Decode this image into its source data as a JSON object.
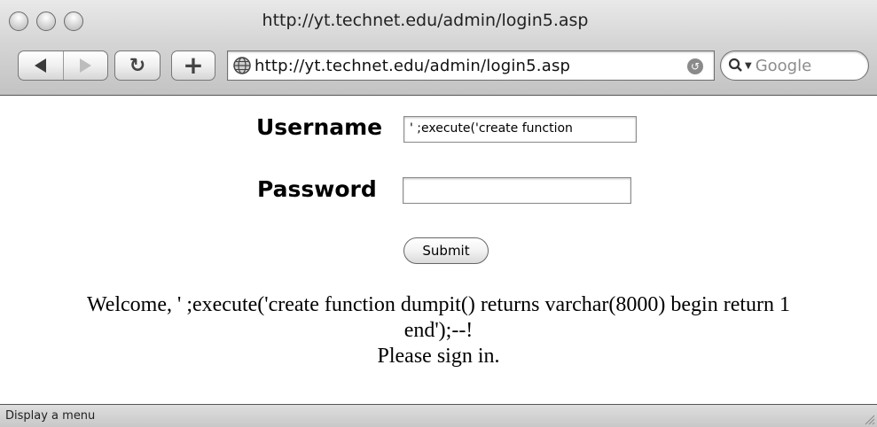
{
  "window": {
    "title": "http://yt.technet.edu/admin/login5.asp"
  },
  "toolbar": {
    "back_icon": "back-arrow-icon",
    "forward_icon": "forward-arrow-icon",
    "reload_glyph": "↻",
    "add_bookmark_glyph": "+",
    "url": "http://yt.technet.edu/admin/login5.asp",
    "search_placeholder": "Google"
  },
  "form": {
    "username_label": "Username",
    "username_value": "' ;execute('create function",
    "password_label": "Password",
    "password_value": "",
    "submit_label": "Submit"
  },
  "message": {
    "line1": "Welcome, ' ;execute('create function dumpit() returns varchar(8000) begin return 1",
    "line2": "end');--!",
    "line3": "Please sign in."
  },
  "statusbar": {
    "text": "Display a menu"
  }
}
